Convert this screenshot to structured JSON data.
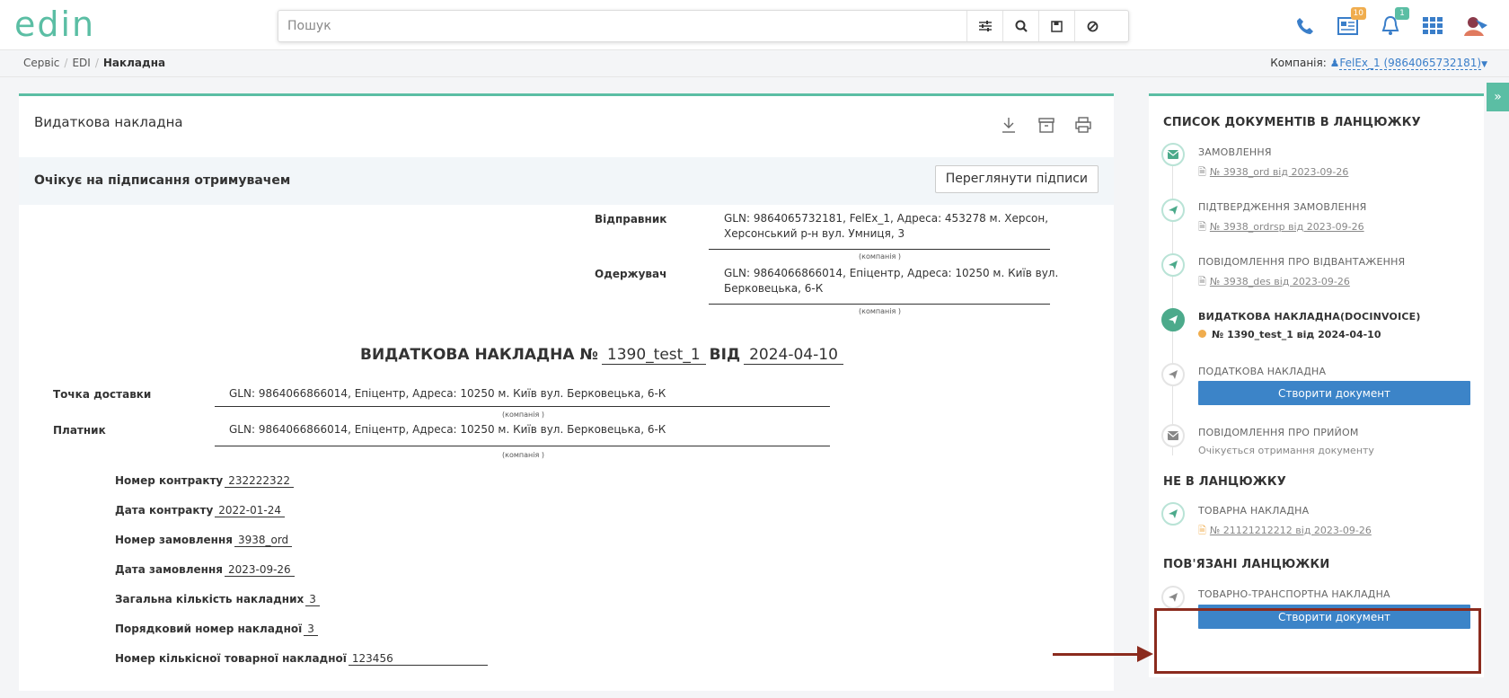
{
  "header": {
    "logo_text": "edin",
    "search_placeholder": "Пошук",
    "news_badge": "10",
    "notif_badge": "1"
  },
  "breadcrumb": [
    "Сервіс",
    "EDI",
    "Накладна"
  ],
  "company": {
    "label": "Компанія:",
    "value": "FelEx_1 (9864065732181)"
  },
  "document": {
    "title": "Видаткова накладна",
    "status": "Очікує на підписання отримувачем",
    "view_signatures": "Переглянути підписи",
    "sender_label": "Відправник",
    "sender_line1": "GLN: 9864065732181, FelEx_1, Адреса: 453278 м. Херсон,",
    "sender_line2": "Херсонський р-н вул. Умниця, 3",
    "company_caption": "(компанія )",
    "receiver_label": "Одержувач",
    "receiver_line1": "GLN: 9864066866014, Епіцентр, Адреса: 10250 м. Київ вул.",
    "receiver_line2": "Берковецька, 6-К",
    "heading_prefix": "ВИДАТКОВА НАКЛАДНА №",
    "number": "1390_test_1",
    "heading_from": "ВІД",
    "date": "2024-04-10",
    "delivery_label": "Точка доставки",
    "delivery_value": "GLN: 9864066866014, Епіцентр, Адреса: 10250 м. Київ вул. Берковецька, 6-К",
    "payer_label": "Платник",
    "payer_value": "GLN: 9864066866014, Епіцентр, Адреса: 10250 м. Київ вул. Берковецька, 6-К",
    "fields": [
      {
        "label": "Номер контракту",
        "value": "232222322"
      },
      {
        "label": "Дата контракту",
        "value": "2022-01-24"
      },
      {
        "label": "Номер замовлення",
        "value": "3938_ord"
      },
      {
        "label": "Дата замовлення",
        "value": "2023-09-26"
      },
      {
        "label": "Загальна кількість накладних",
        "value": "3"
      },
      {
        "label": "Порядковий номер накладної",
        "value": "3"
      },
      {
        "label": "Номер кількісної товарної накладної",
        "value": "123456"
      }
    ]
  },
  "sidebar": {
    "chain_title": "СПИСОК ДОКУМЕНТІВ В ЛАНЦЮЖКУ",
    "chain": [
      {
        "title": "ЗАМОВЛЕННЯ",
        "link": "№ 3938_ord від 2023-09-26"
      },
      {
        "title": "ПІДТВЕРДЖЕННЯ ЗАМОВЛЕННЯ",
        "link": "№ 3938_ordrsp від 2023-09-26"
      },
      {
        "title": "ПОВІДОМЛЕННЯ ПРО ВІДВАНТАЖЕННЯ",
        "link": "№ 3938_des від 2023-09-26"
      },
      {
        "title": "ВИДАТКОВА НАКЛАДНА(DOCINVOICE)",
        "link": "№ 1390_test_1 від 2024-04-10"
      },
      {
        "title": "ПОДАТКОВА НАКЛАДНА",
        "button": "Створити документ"
      },
      {
        "title": "ПОВІДОМЛЕННЯ ПРО ПРИЙОМ",
        "note": "Очікується отримання документу"
      }
    ],
    "not_in_chain_title": "НЕ В ЛАНЦЮЖКУ",
    "not_in_chain": [
      {
        "title": "ТОВАРНА НАКЛАДНА",
        "link": "№ 21121212212 від 2023-09-26"
      }
    ],
    "linked_title": "ПОВ'ЯЗАНІ ЛАНЦЮЖКИ",
    "linked": [
      {
        "title": "ТОВАРНО-ТРАНСПОРТНА НАКЛАДНА",
        "button": "Створити документ"
      }
    ]
  },
  "colors": {
    "accent": "#5bbea4",
    "primary_button": "#3c84c8",
    "highlight": "#8b2b1e",
    "pending_dot": "#f0ad4e"
  }
}
